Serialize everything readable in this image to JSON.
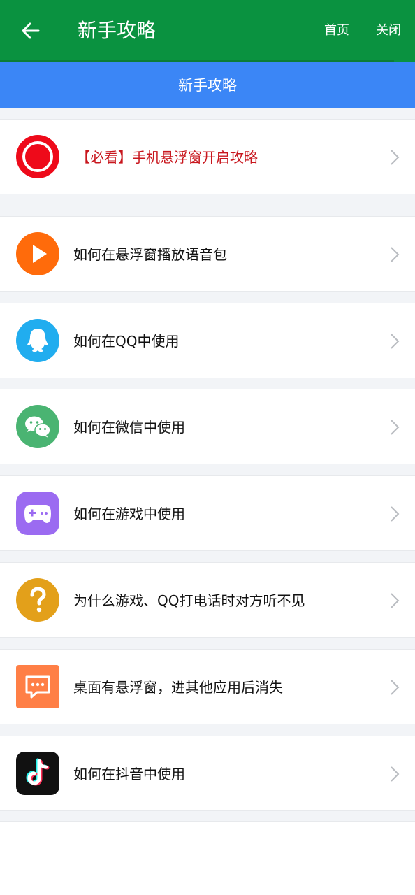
{
  "app_bar": {
    "title": "新手攻略",
    "home_label": "首页",
    "close_label": "关闭"
  },
  "section_header": {
    "title": "新手攻略"
  },
  "items": [
    {
      "label": "【必看】手机悬浮窗开启攻略",
      "icon": "record-icon",
      "color": "#ee0a1a",
      "highlight": true
    },
    {
      "label": "如何在悬浮窗播放语音包",
      "icon": "play-icon",
      "color": "#ff6b0b"
    },
    {
      "label": "如何在QQ中使用",
      "icon": "qq-icon",
      "color": "#21adef"
    },
    {
      "label": "如何在微信中使用",
      "icon": "wechat-icon",
      "color": "#4ab472"
    },
    {
      "label": "如何在游戏中使用",
      "icon": "gamepad-icon",
      "color": "#9b6bf1"
    },
    {
      "label": "为什么游戏、QQ打电话时对方听不见",
      "icon": "question-icon",
      "color": "#e3a01a"
    },
    {
      "label": "桌面有悬浮窗，进其他应用后消失",
      "icon": "chat-bubble-icon",
      "color": "#ff7f46"
    },
    {
      "label": "如何在抖音中使用",
      "icon": "tiktok-icon",
      "color": "#111111"
    }
  ],
  "colors": {
    "app_bar": "#0a9240",
    "header": "#3b86f6",
    "highlight_text": "#c8161d",
    "background": "#f2f4f7"
  }
}
